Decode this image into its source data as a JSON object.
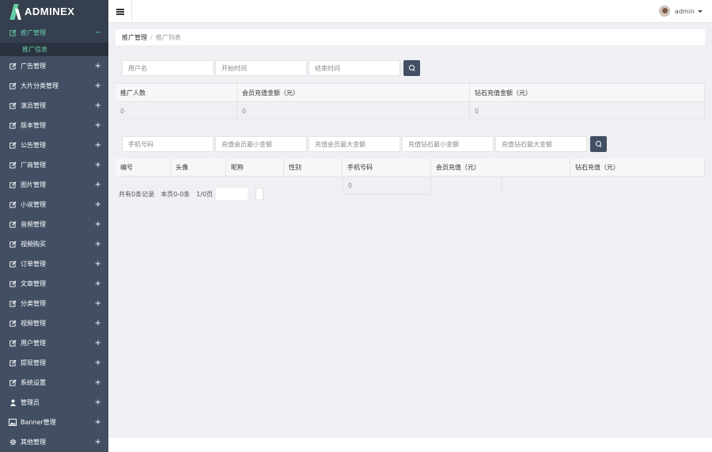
{
  "brand": {
    "name": "ADMINEX"
  },
  "header": {
    "username": "admin"
  },
  "sidebar": {
    "items": [
      {
        "label": "推广管理",
        "icon": "edit-icon",
        "active": true,
        "expander": "−"
      },
      {
        "label": "广告管理",
        "icon": "edit-icon",
        "expander": "+"
      },
      {
        "label": "大片分类管理",
        "icon": "edit-icon",
        "expander": "+"
      },
      {
        "label": "演员管理",
        "icon": "edit-icon",
        "expander": "+"
      },
      {
        "label": "版本管理",
        "icon": "edit-icon",
        "expander": "+"
      },
      {
        "label": "公告管理",
        "icon": "edit-icon",
        "expander": "+"
      },
      {
        "label": "厂商管理",
        "icon": "edit-icon",
        "expander": "+"
      },
      {
        "label": "图片管理",
        "icon": "edit-icon",
        "expander": "+"
      },
      {
        "label": "小说管理",
        "icon": "edit-icon",
        "expander": "+"
      },
      {
        "label": "音频管理",
        "icon": "edit-icon",
        "expander": "+"
      },
      {
        "label": "视频购买",
        "icon": "edit-icon",
        "expander": "+"
      },
      {
        "label": "订单管理",
        "icon": "edit-icon",
        "expander": "+"
      },
      {
        "label": "文章管理",
        "icon": "edit-icon",
        "expander": "+"
      },
      {
        "label": "分类管理",
        "icon": "edit-icon",
        "expander": "+"
      },
      {
        "label": "视频管理",
        "icon": "edit-icon",
        "expander": "+"
      },
      {
        "label": "用户管理",
        "icon": "edit-icon",
        "expander": "+"
      },
      {
        "label": "提现管理",
        "icon": "edit-icon",
        "expander": "+"
      },
      {
        "label": "系统设置",
        "icon": "edit-icon",
        "expander": "+"
      },
      {
        "label": "管理员",
        "icon": "user-icon",
        "expander": "+"
      },
      {
        "label": "Banner管理",
        "icon": "image-icon",
        "expander": "+"
      },
      {
        "label": "其他管理",
        "icon": "gear-icon",
        "expander": "+"
      }
    ],
    "sub_item": "推广信息"
  },
  "breadcrumb": {
    "parent": "推广管理",
    "separator": "/",
    "current": "推广列表"
  },
  "search1": {
    "username_placeholder": "用户名",
    "start_placeholder": "开始时间",
    "end_placeholder": "结束时间"
  },
  "stats": {
    "headers": [
      "推广人数",
      "会员充值金额（元）",
      "钻石充值金额（元）"
    ],
    "values": [
      "0",
      "0",
      "0"
    ]
  },
  "search2": {
    "phone_placeholder": "手机号码",
    "vip_min_placeholder": "充值会员最小金额",
    "vip_max_placeholder": "充值会员最大金额",
    "diamond_min_placeholder": "充值钻石最小金额",
    "diamond_max_placeholder": "充值钻石最大金额"
  },
  "members": {
    "headers": [
      "编号",
      "头像",
      "昵称",
      "性别",
      "手机号码",
      "会员充值（元）",
      "钻石充值（元）"
    ],
    "row": [
      "",
      "",
      "",
      "",
      "0",
      "",
      ""
    ]
  },
  "pager": {
    "total": "共有0条记录",
    "range": "本页0-0条",
    "page": "1/0页"
  },
  "colors": {
    "sidebar": "#424f63",
    "accent": "#65cea7",
    "button": "#424f63"
  }
}
